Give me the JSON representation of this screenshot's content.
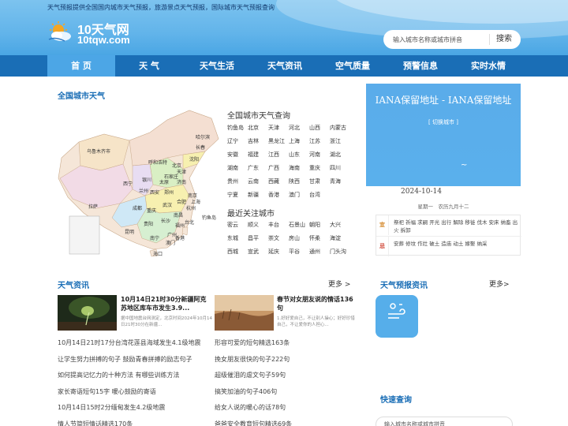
{
  "header": {
    "tagline": "天气预报提供全国国内城市天气预报，旅游景点天气预报，国际城市天气预报查询",
    "logo_line1": "10天气网",
    "logo_line2": "10tqw.com",
    "search_placeholder": "输入城市名称或城市拼音",
    "search_button": "搜索"
  },
  "nav": {
    "items": [
      "首 页",
      "天 气",
      "天气生活",
      "天气资讯",
      "空气质量",
      "预警信息",
      "实时水情"
    ],
    "active_index": 0
  },
  "map_section": {
    "title": "全国城市天气",
    "map_labels": [
      "乌鲁木齐市",
      "哈尔滨",
      "长春",
      "呼和浩特",
      "北京",
      "沈阳",
      "天津",
      "石家庄",
      "银川",
      "太原",
      "济南",
      "西宁",
      "兰州",
      "西安",
      "郑州",
      "南京",
      "合肥",
      "上海",
      "拉萨",
      "成都",
      "武汉",
      "杭州",
      "重庆",
      "长沙",
      "南昌",
      "福州",
      "贵阳",
      "昆明",
      "南宁",
      "广州",
      "台北",
      "钓鱼岛",
      "澳门",
      "海口",
      "香港"
    ],
    "query_title": "全国城市天气查询",
    "cities": [
      "钓鱼岛",
      "北京",
      "天津",
      "河北",
      "山西",
      "内蒙古",
      "辽宁",
      "吉林",
      "黑龙江",
      "上海",
      "江苏",
      "浙江",
      "安徽",
      "福建",
      "江西",
      "山东",
      "河南",
      "湖北",
      "湖南",
      "广东",
      "广西",
      "海南",
      "重庆",
      "四川",
      "贵州",
      "云南",
      "西藏",
      "陕西",
      "甘肃",
      "青海",
      "宁夏",
      "新疆",
      "香港",
      "澳门",
      "台湾"
    ],
    "hot_title": "最近关注城市",
    "hot_cities": [
      "密云",
      "顺义",
      "丰台",
      "石景山",
      "朝阳",
      "大兴",
      "东城",
      "昌平",
      "崇文",
      "房山",
      "怀柔",
      "海淀",
      "西城",
      "宣武",
      "延庆",
      "平谷",
      "通州",
      "门头沟"
    ]
  },
  "weather_card": {
    "title": "IANA保留地址 - IANA保留地址",
    "switch_label": "[ 切换城市 ]",
    "tilde": "~",
    "date": "2024-10-14",
    "lunar": "星期一　农历九月十二",
    "yi_label": "宜",
    "yi_text": "祭祀 祈福 求嗣 开光 出行 解除 移徙 伐木 安床 纳畜 出火 拆卸",
    "ji_label": "忌",
    "ji_text": "安葬 修坟 作灶 破土 造庙 动土 嫁娶 纳采"
  },
  "news": {
    "title": "天气资讯",
    "more": "更多 >",
    "feature1_title": "10月14日21时30分新疆阿克苏地区库车市发生3.9...",
    "feature1_sub": "据中国地震台网测定，北京时间2024年10月14日21时30分在新疆...",
    "feature2_title": "春节对女朋友说的情话136句",
    "feature2_sub": "1.好好爱自己，不让别人操心；好好珍惜自己，不让爱你的人担心...",
    "list_left": [
      "10月14日21时17分台湾花莲县海域发生4.1级地震",
      "让学生努力拼搏的句子 鼓励青春拼搏的励志句子",
      "如何提高记忆力的十种方法 有哪些训练方法",
      "家长寄语短句15字 暖心鼓励的寄语",
      "10月14日15时2分缅甸发生4.2级地震",
      "情人节简短情话精选170条"
    ],
    "list_right": [
      "形容可爱的短句精选163条",
      "挽女朋友很快的句子222句",
      "超级催泪的虐文句子59句",
      "搞笑加油的句子406句",
      "给女人说的暖心的话78句",
      "爸爸安全教育短句精选69条"
    ]
  },
  "forecast_news": {
    "title": "天气预报资讯",
    "more": "更多>"
  },
  "quick_search": {
    "title": "快速查询",
    "placeholder": "输入城市名称或城市拼音"
  }
}
